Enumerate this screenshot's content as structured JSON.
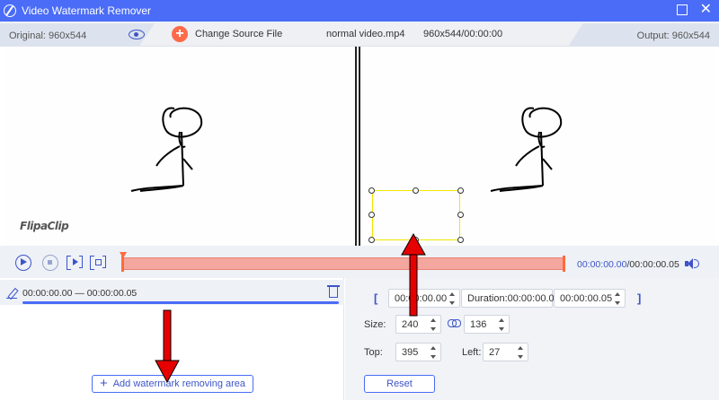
{
  "app": {
    "title": "Video Watermark Remover"
  },
  "infobar": {
    "original_label": "Original: 960x544",
    "change_source_label": "Change Source File",
    "filename": "normal video.mp4",
    "file_info": "960x544/00:00:00",
    "output_label": "Output: 960x544"
  },
  "preview": {
    "watermark_text": "FlipaClip"
  },
  "playback": {
    "current_time": "00:00:00.00",
    "total_time": "/00:00:00.05",
    "progress": 0.0
  },
  "segment": {
    "range": "00:00:00.00 — 00:00:00.05",
    "progress": 1.0
  },
  "settings": {
    "start_time": "00:00:00.00",
    "duration_label": "Duration:00:00:00.05",
    "end_time": "00:00:00.05",
    "size_label": "Size:",
    "width": "240",
    "height": "136",
    "top_label": "Top:",
    "top": "395",
    "left_label": "Left:",
    "left": "27",
    "open_bracket": "[",
    "close_bracket": "]",
    "reset_label": "Reset"
  },
  "actions": {
    "add_area_plus": "+",
    "add_area_label": "Add watermark removing area",
    "change_source_plus": "+"
  },
  "colors": {
    "accent": "#4a6cf7",
    "annotation_arrow": "#e60000",
    "selection_box": "#f2e600",
    "timeline_fill": "#f4a79e"
  },
  "icons": [
    "app-logo-icon",
    "eye-icon",
    "plus-circle-icon",
    "play-icon",
    "stop-icon",
    "next-frame-icon",
    "frame-capture-icon",
    "volume-icon",
    "edit-icon",
    "trash-icon",
    "link-icon"
  ]
}
